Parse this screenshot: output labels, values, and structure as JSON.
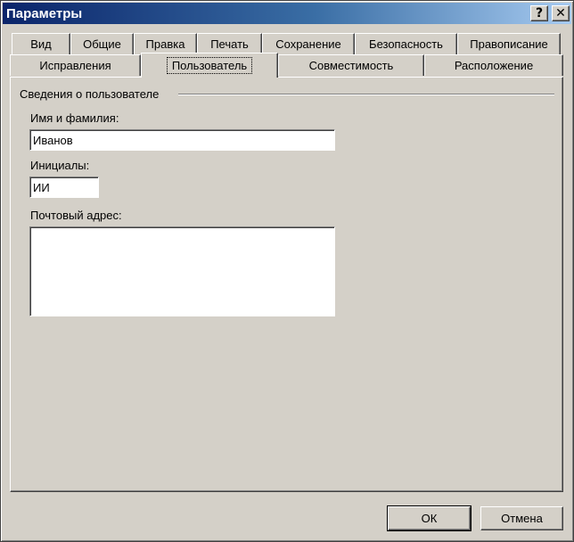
{
  "window": {
    "title": "Параметры",
    "help_button": "?",
    "close_button": "✕"
  },
  "tabs": {
    "row1": [
      {
        "label": "Вид",
        "active": false
      },
      {
        "label": "Общие",
        "active": false
      },
      {
        "label": "Правка",
        "active": false
      },
      {
        "label": "Печать",
        "active": false
      },
      {
        "label": "Сохранение",
        "active": false
      },
      {
        "label": "Безопасность",
        "active": false
      },
      {
        "label": "Правописание",
        "active": false
      }
    ],
    "row2": [
      {
        "label": "Исправления",
        "active": false
      },
      {
        "label": "Пользователь",
        "active": true
      },
      {
        "label": "Совместимость",
        "active": false
      },
      {
        "label": "Расположение",
        "active": false
      }
    ]
  },
  "user_info": {
    "group_title": "Сведения о пользователе",
    "name_label": "Имя и фамилия:",
    "name_value": "Иванов",
    "initials_label": "Инициалы:",
    "initials_value": "ИИ",
    "address_label": "Почтовый адрес:",
    "address_value": ""
  },
  "buttons": {
    "ok": "ОК",
    "cancel": "Отмена"
  },
  "colors": {
    "face": "#d4d0c8",
    "title_start": "#0a246a",
    "title_end": "#a6caf0"
  }
}
